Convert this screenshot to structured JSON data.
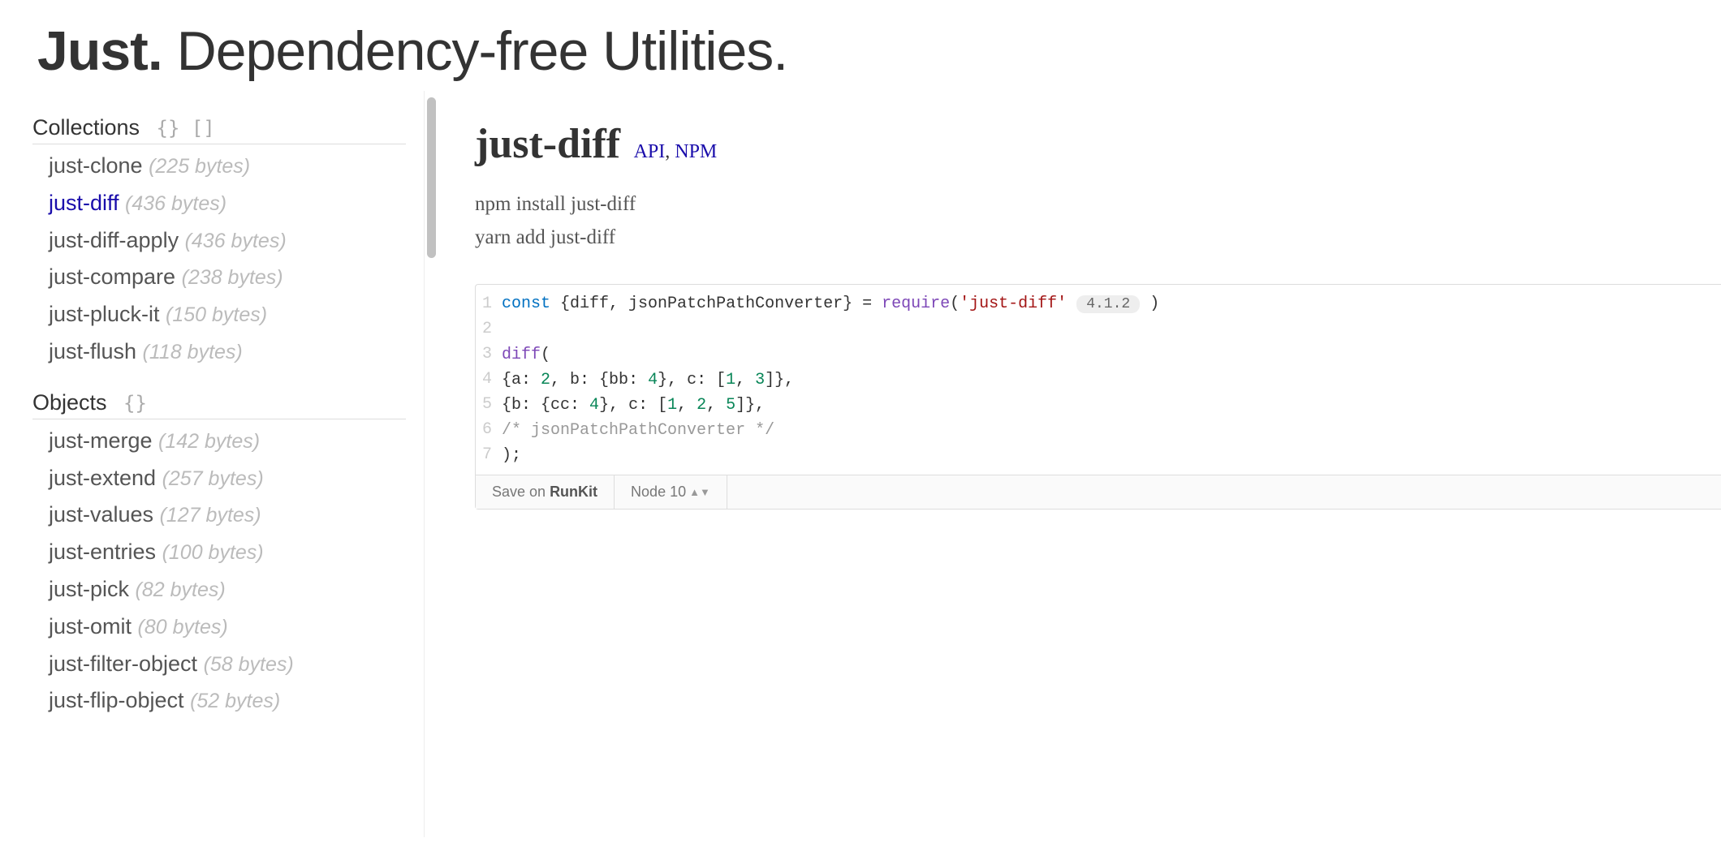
{
  "header": {
    "title_bold": "Just.",
    "title_rest": "  Dependency-free Utilities."
  },
  "sidebar": {
    "sections": [
      {
        "label": "Collections",
        "glyphs": "{} []",
        "items": [
          {
            "name": "just-clone",
            "size": "(225 bytes)",
            "active": false
          },
          {
            "name": "just-diff",
            "size": "(436 bytes)",
            "active": true
          },
          {
            "name": "just-diff-apply",
            "size": "(436 bytes)",
            "active": false
          },
          {
            "name": "just-compare",
            "size": "(238 bytes)",
            "active": false
          },
          {
            "name": "just-pluck-it",
            "size": "(150 bytes)",
            "active": false
          },
          {
            "name": "just-flush",
            "size": "(118 bytes)",
            "active": false
          }
        ]
      },
      {
        "label": "Objects",
        "glyphs": "{}",
        "items": [
          {
            "name": "just-merge",
            "size": "(142 bytes)",
            "active": false
          },
          {
            "name": "just-extend",
            "size": "(257 bytes)",
            "active": false
          },
          {
            "name": "just-values",
            "size": "(127 bytes)",
            "active": false
          },
          {
            "name": "just-entries",
            "size": "(100 bytes)",
            "active": false
          },
          {
            "name": "just-pick",
            "size": "(82 bytes)",
            "active": false
          },
          {
            "name": "just-omit",
            "size": "(80 bytes)",
            "active": false
          },
          {
            "name": "just-filter-object",
            "size": "(58 bytes)",
            "active": false
          },
          {
            "name": "just-flip-object",
            "size": "(52 bytes)",
            "active": false
          }
        ]
      }
    ]
  },
  "main": {
    "package_name": "just-diff",
    "links": {
      "api": "API",
      "separator": ", ",
      "npm": "NPM"
    },
    "install_npm": "npm install just-diff",
    "install_yarn": "yarn add just-diff",
    "version_badge": "4.1.2",
    "code": {
      "line1": {
        "kw": "const",
        "mid": " {diff, jsonPatchPathConverter} = ",
        "req": "require",
        "open": "(",
        "str": "'just-diff'",
        "close": ")"
      },
      "line3": {
        "fn": "diff",
        "open": "("
      },
      "line4": {
        "pre": "  {a: ",
        "n1": "2",
        "mid1": ", b: {bb: ",
        "n2": "4",
        "mid2": "}, c: [",
        "n3": "1",
        "mid3": ", ",
        "n4": "3",
        "end": "]},"
      },
      "line5": {
        "pre": "  {b: {cc: ",
        "n1": "4",
        "mid1": "}, c: [",
        "n2": "1",
        "mid2": ", ",
        "n3": "2",
        "mid3": ", ",
        "n4": "5",
        "end": "]},"
      },
      "line6": "  /* jsonPatchPathConverter */",
      "line7": ");"
    },
    "footer": {
      "save_pre": "Save on ",
      "save_bold": "RunKit",
      "node": "Node 10"
    }
  }
}
